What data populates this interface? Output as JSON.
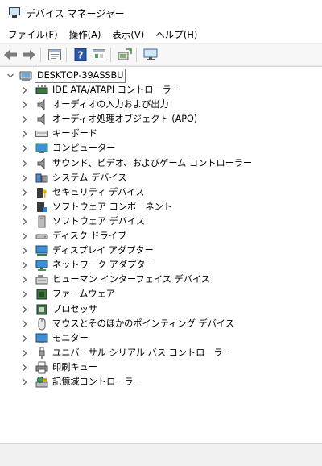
{
  "window": {
    "title": "デバイス マネージャー"
  },
  "menu": [
    "ファイル(F)",
    "操作(A)",
    "表示(V)",
    "ヘルプ(H)"
  ],
  "toolbar": [
    "back",
    "forward",
    "properties",
    "help",
    "show-hidden",
    "update",
    "scan-hardware"
  ],
  "tree": {
    "root": "DESKTOP-39ASSBU",
    "items": [
      {
        "label": "IDE ATA/ATAPI コントローラー",
        "icon": "ide-controller-icon"
      },
      {
        "label": "オーディオの入力および出力",
        "icon": "speaker-icon"
      },
      {
        "label": "オーディオ処理オブジェクト (APO)",
        "icon": "speaker-icon"
      },
      {
        "label": "キーボード",
        "icon": "keyboard-icon"
      },
      {
        "label": "コンピューター",
        "icon": "computer-icon"
      },
      {
        "label": "サウンド、ビデオ、およびゲーム コントローラー",
        "icon": "speaker-icon"
      },
      {
        "label": "システム デバイス",
        "icon": "system-device-icon"
      },
      {
        "label": "セキュリティ デバイス",
        "icon": "security-key-icon"
      },
      {
        "label": "ソフトウェア コンポーネント",
        "icon": "software-component-icon"
      },
      {
        "label": "ソフトウェア デバイス",
        "icon": "software-device-icon"
      },
      {
        "label": "ディスク ドライブ",
        "icon": "disk-drive-icon"
      },
      {
        "label": "ディスプレイ アダプター",
        "icon": "display-adapter-icon"
      },
      {
        "label": "ネットワーク アダプター",
        "icon": "network-adapter-icon"
      },
      {
        "label": "ヒューマン インターフェイス デバイス",
        "icon": "hid-icon"
      },
      {
        "label": "ファームウェア",
        "icon": "firmware-icon"
      },
      {
        "label": "プロセッサ",
        "icon": "processor-icon"
      },
      {
        "label": "マウスとそのほかのポインティング デバイス",
        "icon": "mouse-icon"
      },
      {
        "label": "モニター",
        "icon": "monitor-icon"
      },
      {
        "label": "ユニバーサル シリアル バス コントローラー",
        "icon": "usb-icon"
      },
      {
        "label": "印刷キュー",
        "icon": "printer-icon"
      },
      {
        "label": "記憶域コントローラー",
        "icon": "storage-controller-icon"
      }
    ]
  }
}
